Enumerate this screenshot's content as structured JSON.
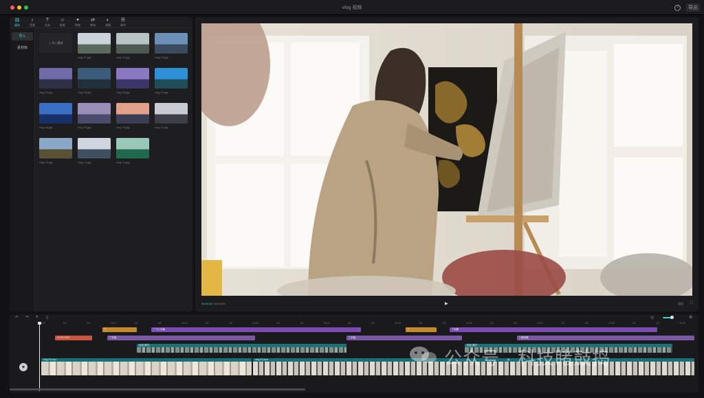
{
  "window": {
    "title": "vlog 视频",
    "help_icon": "?",
    "export_label": "导出"
  },
  "media_toolbar": {
    "tools": [
      {
        "icon": "media-icon",
        "glyph": "▤",
        "label": "媒体",
        "active": true
      },
      {
        "icon": "audio-icon",
        "glyph": "♪",
        "label": "音频"
      },
      {
        "icon": "text-icon",
        "glyph": "T",
        "label": "文本"
      },
      {
        "icon": "sticker-icon",
        "glyph": "☺",
        "label": "贴纸"
      },
      {
        "icon": "effects-icon",
        "glyph": "✦",
        "label": "特效"
      },
      {
        "icon": "transition-icon",
        "glyph": "⇄",
        "label": "转场"
      },
      {
        "icon": "filter-icon",
        "glyph": "◐",
        "label": "滤镜"
      },
      {
        "icon": "adjust-icon",
        "glyph": "☰",
        "label": "调节"
      }
    ]
  },
  "sidebar": {
    "items": [
      {
        "label": "导入",
        "active": true
      },
      {
        "label": "素材库"
      }
    ]
  },
  "media": {
    "import_label": "导入素材",
    "thumbs": [
      {
        "caption": "vlog 01.jpg",
        "sky": "#c9d3d8",
        "ground": "#5a6a5e"
      },
      {
        "caption": "vlog 02.jpg",
        "sky": "#b8c3c6",
        "ground": "#4c5a52"
      },
      {
        "caption": "vlog 03.jpg",
        "sky": "#6c8fb8",
        "ground": "#3b4a5e"
      },
      {
        "caption": "vlog 04.jpg",
        "sky": "#6f6aa8",
        "ground": "#2d3047"
      },
      {
        "caption": "vlog 05.jpg",
        "sky": "#3b5b7a",
        "ground": "#22303a"
      },
      {
        "caption": "vlog 06.jpg",
        "sky": "#8a78c0",
        "ground": "#3c3568"
      },
      {
        "caption": "vlog 07.jpg",
        "sky": "#2f8fd6",
        "ground": "#1f4e5a"
      },
      {
        "caption": "vlog 08.jpg",
        "sky": "#3a6fc4",
        "ground": "#17306a"
      },
      {
        "caption": "vlog 09.jpg",
        "sky": "#9a8fb8",
        "ground": "#4a4a6a"
      },
      {
        "caption": "vlog 10.jpg",
        "sky": "#e0a08a",
        "ground": "#3a3f55"
      },
      {
        "caption": "vlog 11.jpg",
        "sky": "#c8ccd2",
        "ground": "#3c4046"
      },
      {
        "caption": "vlog 12.jpg",
        "sky": "#8aa8c8",
        "ground": "#5a5036"
      },
      {
        "caption": "vlog 13.jpg",
        "sky": "#cfd6e0",
        "ground": "#3f4f62"
      },
      {
        "caption": "vlog 14.jpg",
        "sky": "#9ac8b8",
        "ground": "#1f6a4e"
      }
    ]
  },
  "preview": {
    "current_time": "00:00:00",
    "total_time": "00:03:20",
    "ratio_label": "适应",
    "play_icon": "▶",
    "fullscreen_icon": "⛶"
  },
  "timeline": {
    "tools": [
      {
        "icon": "undo-icon",
        "glyph": "↶"
      },
      {
        "icon": "redo-icon",
        "glyph": "↷"
      },
      {
        "icon": "split-icon",
        "glyph": "⏸"
      },
      {
        "icon": "delete-icon",
        "glyph": "▯"
      }
    ],
    "right_tools": [
      {
        "icon": "snap-icon",
        "glyph": "◎"
      },
      {
        "icon": "settings-icon",
        "glyph": "⚙"
      }
    ],
    "ticks": [
      "00:00",
      "10f",
      "20f",
      "00:01",
      "10f",
      "20f",
      "00:02",
      "10f",
      "20f",
      "00:03",
      "10f",
      "20f",
      "00:04",
      "10f",
      "20f",
      "00:05",
      "10f",
      "20f",
      "00:06",
      "10f",
      "20f",
      "00:07",
      "10f",
      "20f",
      "00:08",
      "10f",
      "20f",
      "00:09"
    ],
    "row1": [
      {
        "label": "T",
        "color": "c-orange"
      },
      {
        "label": "T 飞入字幕",
        "color": "c-purple"
      },
      {
        "label": "T",
        "color": "c-orange"
      },
      {
        "label": "T 标题",
        "color": "c-purple"
      }
    ],
    "row2": [
      {
        "label": "VLOG 2022",
        "color": "c-red"
      },
      {
        "label": "T 字幕",
        "color": "c-lpurple"
      },
      {
        "label": "T 字幕",
        "color": "c-lpurple"
      },
      {
        "label": "T 副标题",
        "color": "c-lpurple"
      }
    ],
    "stickers": [
      {
        "label": "贴纸 素材"
      },
      {
        "label": "贴纸 素材"
      }
    ],
    "main": [
      {
        "label": "vlog 01.mp4"
      },
      {
        "label": "vlog 02.mp4"
      }
    ],
    "cover_label": "封面"
  },
  "watermark": "公众号 · 科技睹鼓捣"
}
